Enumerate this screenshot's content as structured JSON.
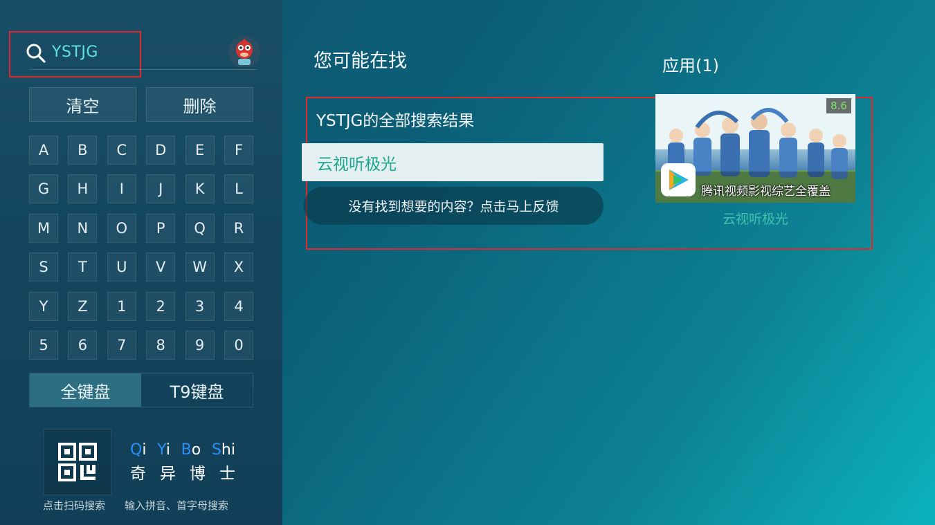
{
  "search": {
    "query": "YSTJG"
  },
  "keyboard": {
    "clear_label": "清空",
    "delete_label": "删除",
    "keys": [
      "A",
      "B",
      "C",
      "D",
      "E",
      "F",
      "G",
      "H",
      "I",
      "J",
      "K",
      "L",
      "M",
      "N",
      "O",
      "P",
      "Q",
      "R",
      "S",
      "T",
      "U",
      "V",
      "W",
      "X",
      "Y",
      "Z",
      "1",
      "2",
      "3",
      "4",
      "5",
      "6",
      "7",
      "8",
      "9",
      "0"
    ],
    "full_kb_label": "全键盘",
    "t9_kb_label": "T9键盘",
    "active_mode": "全键盘"
  },
  "footer": {
    "qr_caption": "点击扫码搜索",
    "pinyin_caption": "输入拼音、首字母搜索",
    "logo": {
      "pinyin": [
        {
          "cap": "Q",
          "rest": "i"
        },
        {
          "cap": "Y",
          "rest": "i"
        },
        {
          "cap": "B",
          "rest": "o"
        },
        {
          "cap": "S",
          "rest": "hi"
        }
      ],
      "chinese": [
        "奇",
        "异",
        "博",
        "士"
      ]
    }
  },
  "results": {
    "section_title": "您可能在找",
    "all_results_label": "YSTJG的全部搜索结果",
    "suggestion": "云视听极光",
    "feedback_label": "没有找到想要的内容？点击马上反馈"
  },
  "apps": {
    "header": "应用(1)",
    "items": [
      {
        "name": "云视听极光",
        "rating": "8.6",
        "thumb_caption": "腾讯视频影视综艺全覆盖"
      }
    ]
  },
  "colors": {
    "accent_cyan": "#5fe3e0",
    "suggestion_green": "#1ea58e",
    "app_name_teal": "#41c2b2",
    "highlight_red": "#e02a2a",
    "logo_blue": "#2a8ef7"
  }
}
